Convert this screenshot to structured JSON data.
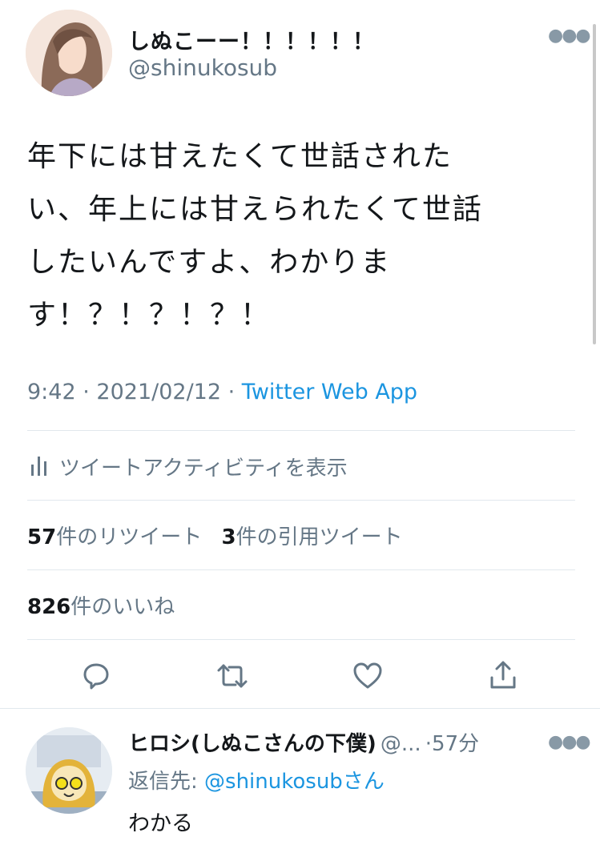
{
  "tweet": {
    "display_name": "しぬこーー！！！！！！",
    "handle": "@shinukosub",
    "text_lines": [
      "年下には甘えたくて世話された",
      "い、年上には甘えられたくて世話",
      "したいんですよ、わかりま",
      "す！？！？！？！"
    ],
    "time": "9:42",
    "date": "2021/02/12",
    "source": "Twitter Web App",
    "activity_label": "ツイートアクティビティを表示",
    "retweet_count": "57",
    "retweet_suffix": "件のリツイート",
    "quote_count": "3",
    "quote_suffix": "件の引用ツイート",
    "like_count": "826",
    "like_suffix": "件のいいね"
  },
  "icons": {
    "more": "more-icon",
    "activity": "analytics-icon",
    "reply": "reply-icon",
    "retweet": "retweet-icon",
    "like": "heart-icon",
    "share": "share-icon"
  },
  "reply": {
    "display_name": "ヒロシ(しぬこさんの下僕)",
    "handle": "@...",
    "time": "57分",
    "reply_to_prefix": "返信先: ",
    "reply_to_handle": "@shinukosub",
    "reply_to_suffix": "さん",
    "text": "わかる"
  },
  "colors": {
    "link": "#1b95e0",
    "muted": "#657786",
    "divider": "#e1e8ed"
  }
}
